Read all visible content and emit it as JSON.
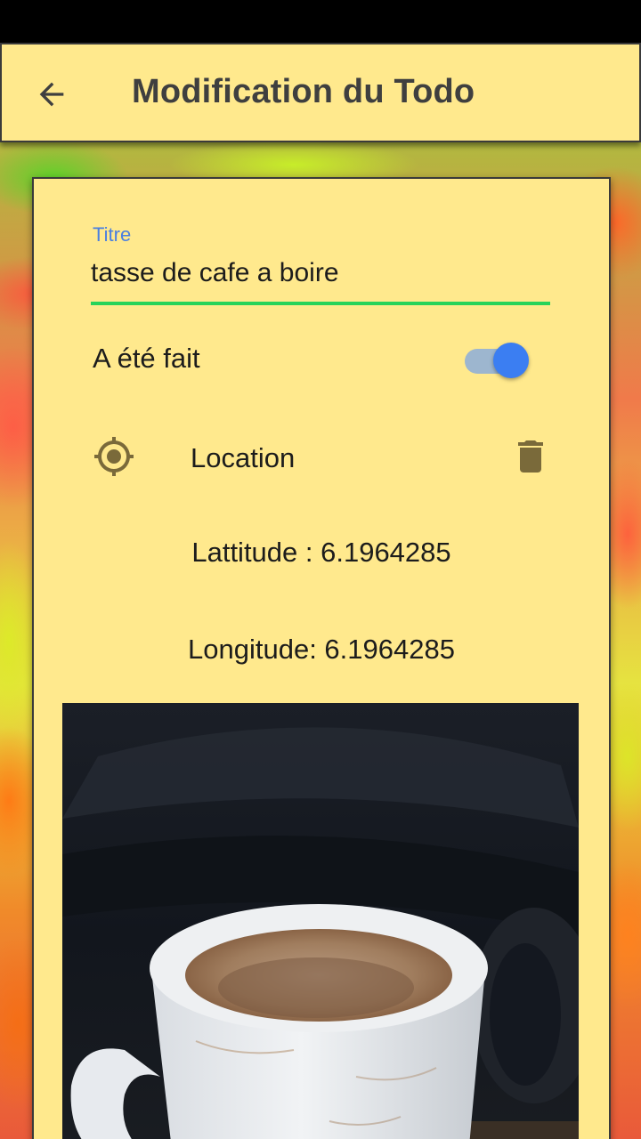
{
  "appbar": {
    "title": "Modification du Todo",
    "back_icon": "arrow-back-icon"
  },
  "form": {
    "title_field": {
      "label": "Titre",
      "value": "tasse de cafe a boire"
    },
    "done": {
      "label": "A été fait",
      "checked": true
    },
    "location": {
      "label": "Location",
      "location_icon": "gps-fixed-icon",
      "delete_icon": "trash-icon"
    },
    "latitude_text": "Lattitude : 6.1964285",
    "longitude_text": "Longitude: 6.1964285"
  },
  "colors": {
    "card_background": "#ffe98d",
    "accent_blue": "#3b7ef2",
    "underline_green": "#27d35a",
    "label_blue": "#4a7fe0"
  }
}
